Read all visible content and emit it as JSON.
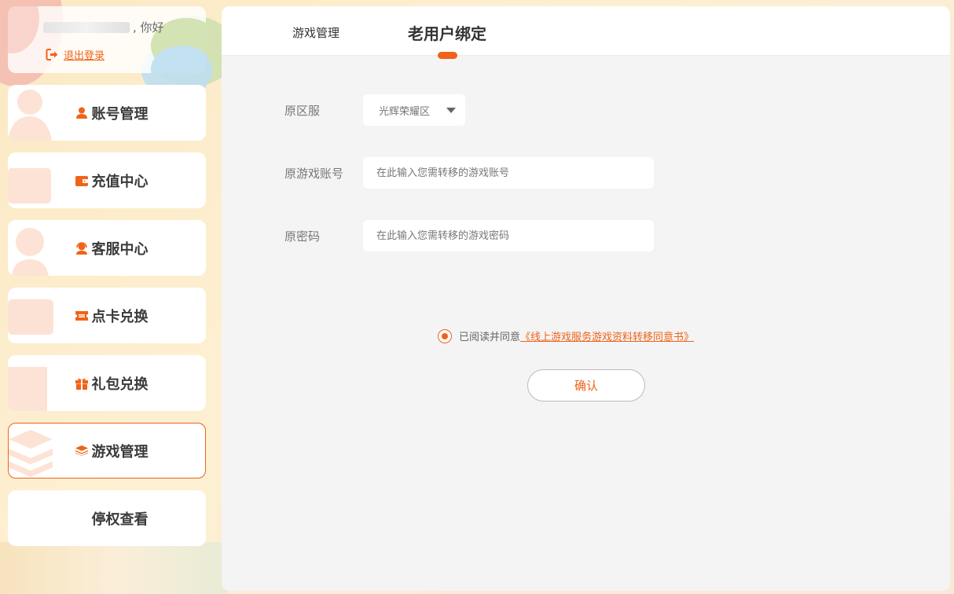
{
  "user": {
    "greeting_suffix": ", 你好",
    "logout_label": "退出登录"
  },
  "nav": {
    "items": [
      {
        "label": "账号管理",
        "icon": "user-icon"
      },
      {
        "label": "充值中心",
        "icon": "wallet-icon"
      },
      {
        "label": "客服中心",
        "icon": "headset-icon"
      },
      {
        "label": "点卡兑换",
        "icon": "ticket-icon"
      },
      {
        "label": "礼包兑换",
        "icon": "gift-icon"
      },
      {
        "label": "游戏管理",
        "icon": "layers-icon",
        "active": true
      },
      {
        "label": "停权查看",
        "icon": ""
      }
    ]
  },
  "tabs": {
    "game_manage": "游戏管理",
    "bind_old_user": "老用户绑定"
  },
  "form": {
    "server_label": "原区服",
    "server_value": "光辉荣耀区",
    "account_label": "原游戏账号",
    "account_placeholder": "在此输入您需转移的游戏账号",
    "password_label": "原密码",
    "password_placeholder": "在此输入您需转移的游戏密码"
  },
  "agreement": {
    "prefix": "已阅读并同意",
    "link": "《线上游戏服务游戏资料转移同意书》"
  },
  "confirm_label": "确认",
  "colors": {
    "accent": "#f06318",
    "panel_bg": "#f4f4f4"
  }
}
